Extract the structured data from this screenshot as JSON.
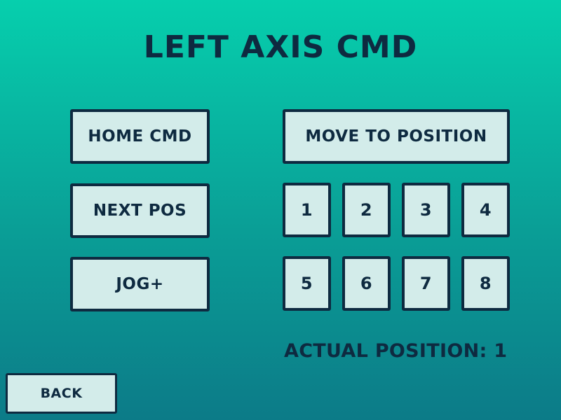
{
  "screen": {
    "title": "LEFT AXIS CMD"
  },
  "left_buttons": {
    "home_cmd": "HOME CMD",
    "next_pos": "NEXT POS",
    "jog_plus": "JOG+"
  },
  "move": {
    "label": "MOVE TO POSITION",
    "positions": [
      "1",
      "2",
      "3",
      "4",
      "5",
      "6",
      "7",
      "8"
    ]
  },
  "status": {
    "label": "ACTUAL POSITION:",
    "value": "1"
  },
  "nav": {
    "back": "BACK"
  },
  "colors": {
    "background_top": "#06cfad",
    "background_bottom": "#0c7b88",
    "button_fill": "#d3ecea",
    "text_and_border": "#0e2a40"
  }
}
